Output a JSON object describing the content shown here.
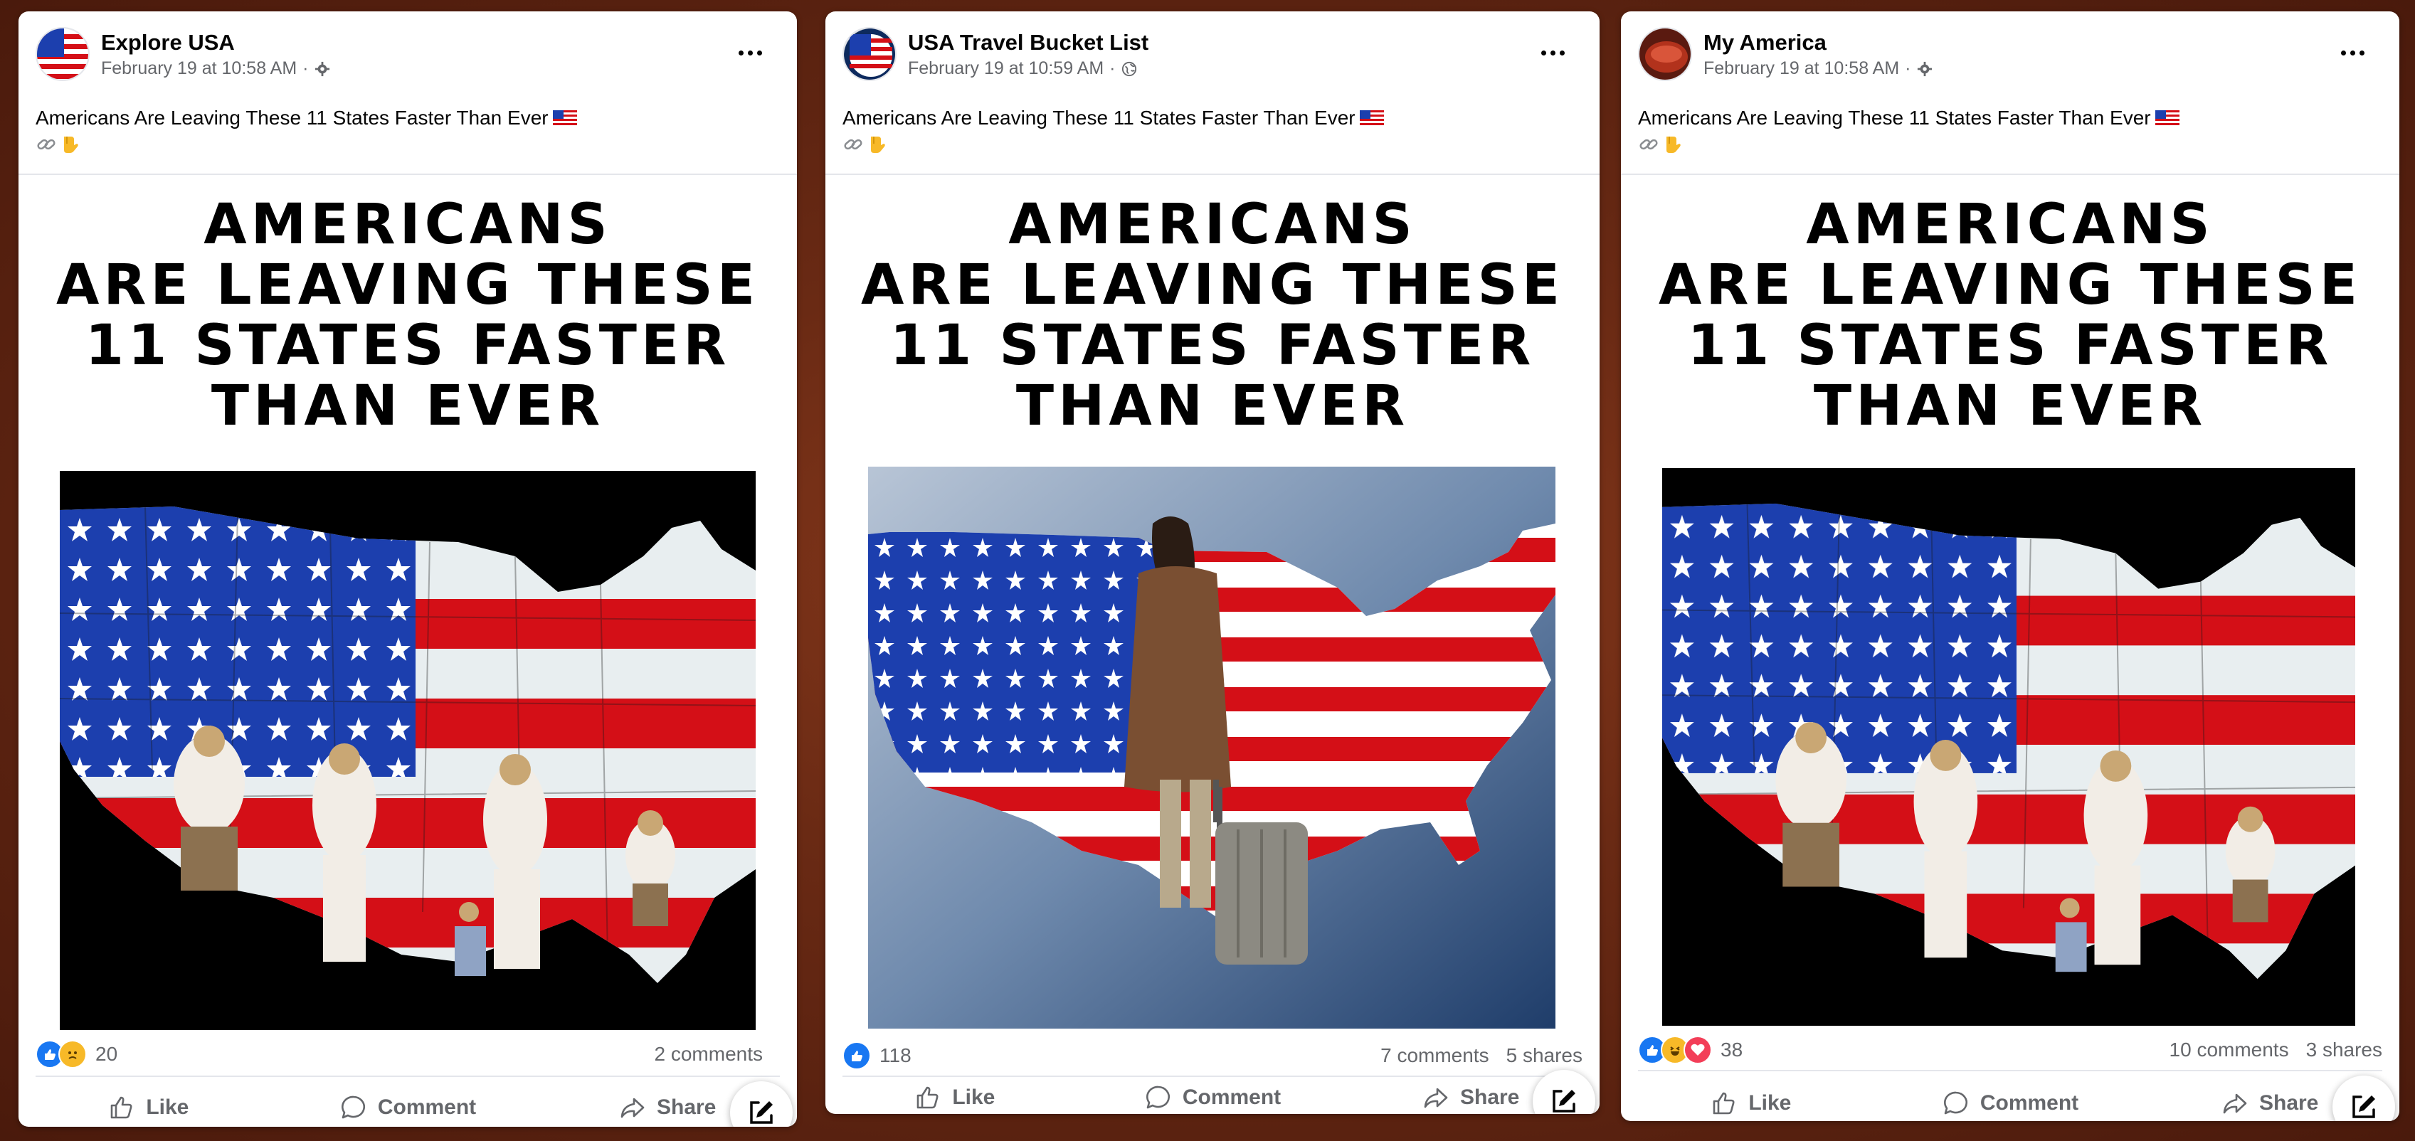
{
  "posts": [
    {
      "page_name": "Explore USA",
      "timestamp": "February 19 at 10:58 AM",
      "privacy_icon": "gear-icon",
      "caption": "Americans Are Leaving These 11 States Faster Than Ever",
      "headline": [
        "AMERICANS",
        "ARE LEAVING THESE",
        "11 STATES FASTER",
        "THAN EVER"
      ],
      "reactions": [
        "like",
        "sad"
      ],
      "reaction_count": "20",
      "comments": "2 comments",
      "shares": "",
      "actions": {
        "like": "Like",
        "comment": "Comment",
        "share": "Share"
      }
    },
    {
      "page_name": "USA Travel Bucket List",
      "timestamp": "February 19 at 10:59 AM",
      "privacy_icon": "globe-icon",
      "caption": "Americans Are Leaving These 11 States Faster Than Ever",
      "headline": [
        "AMERICANS",
        "ARE LEAVING THESE",
        "11 STATES FASTER",
        "THAN EVER"
      ],
      "reactions": [
        "like"
      ],
      "reaction_count": "118",
      "comments": "7 comments",
      "shares": "5 shares",
      "actions": {
        "like": "Like",
        "comment": "Comment",
        "share": "Share"
      }
    },
    {
      "page_name": "My America",
      "timestamp": "February 19 at 10:58 AM",
      "privacy_icon": "gear-icon",
      "caption": "Americans Are Leaving These 11 States Faster Than Ever",
      "headline": [
        "AMERICANS",
        "ARE LEAVING THESE",
        "11 STATES FASTER",
        "THAN EVER"
      ],
      "reactions": [
        "like",
        "haha",
        "love"
      ],
      "reaction_count": "38",
      "comments": "10 comments",
      "shares": "3 shares",
      "actions": {
        "like": "Like",
        "comment": "Comment",
        "share": "Share"
      }
    }
  ],
  "colors": {
    "flag_blue": "#1c3fae",
    "flag_red": "#d40f17",
    "like_blue": "#1877f2",
    "love_red": "#f33e58",
    "text_secondary": "#65676b"
  }
}
